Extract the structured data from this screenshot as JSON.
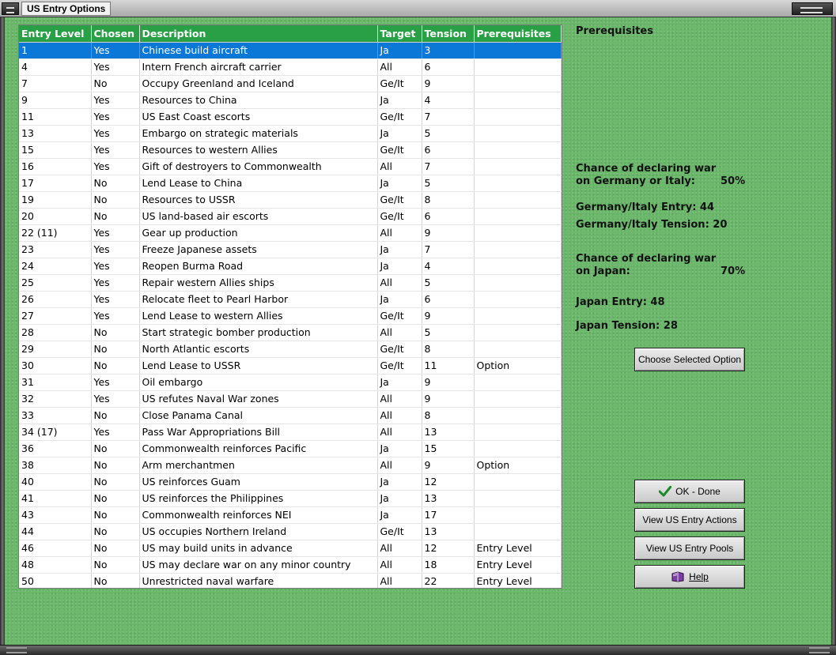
{
  "window": {
    "title": "US Entry Options"
  },
  "table": {
    "columns": [
      "Entry Level",
      "Chosen",
      "Description",
      "Target",
      "Tension",
      "Prerequisites"
    ],
    "selected_index": 0,
    "rows": [
      [
        "1",
        "Yes",
        "Chinese build aircraft",
        "Ja",
        "3",
        ""
      ],
      [
        "4",
        "Yes",
        "Intern French aircraft carrier",
        "All",
        "6",
        ""
      ],
      [
        "7",
        "No",
        "Occupy Greenland and Iceland",
        "Ge/It",
        "9",
        ""
      ],
      [
        "9",
        "Yes",
        "Resources to China",
        "Ja",
        "4",
        ""
      ],
      [
        "11",
        "Yes",
        "US East Coast escorts",
        "Ge/It",
        "7",
        ""
      ],
      [
        "13",
        "Yes",
        "Embargo on strategic materials",
        "Ja",
        "5",
        ""
      ],
      [
        "15",
        "Yes",
        "Resources to western Allies",
        "Ge/It",
        "6",
        ""
      ],
      [
        "16",
        "Yes",
        "Gift of destroyers to Commonwealth",
        "All",
        "7",
        ""
      ],
      [
        "17",
        "No",
        "Lend Lease to China",
        "Ja",
        "5",
        ""
      ],
      [
        "19",
        "No",
        "Resources to USSR",
        "Ge/It",
        "8",
        ""
      ],
      [
        "20",
        "No",
        "US land-based air escorts",
        "Ge/It",
        "6",
        ""
      ],
      [
        "22 (11)",
        "Yes",
        "Gear up production",
        "All",
        "9",
        ""
      ],
      [
        "23",
        "Yes",
        "Freeze Japanese assets",
        "Ja",
        "7",
        ""
      ],
      [
        "24",
        "Yes",
        "Reopen Burma Road",
        "Ja",
        "4",
        ""
      ],
      [
        "25",
        "Yes",
        "Repair western Allies ships",
        "All",
        "5",
        ""
      ],
      [
        "26",
        "Yes",
        "Relocate fleet to Pearl Harbor",
        "Ja",
        "6",
        ""
      ],
      [
        "27",
        "Yes",
        "Lend Lease to western Allies",
        "Ge/It",
        "9",
        ""
      ],
      [
        "28",
        "No",
        "Start strategic bomber production",
        "All",
        "5",
        ""
      ],
      [
        "29",
        "No",
        "North Atlantic escorts",
        "Ge/It",
        "8",
        ""
      ],
      [
        "30",
        "No",
        "Lend Lease to USSR",
        "Ge/It",
        "11",
        "Option"
      ],
      [
        "31",
        "Yes",
        "Oil embargo",
        "Ja",
        "9",
        ""
      ],
      [
        "32",
        "Yes",
        "US refutes Naval War zones",
        "All",
        "9",
        ""
      ],
      [
        "33",
        "No",
        "Close Panama Canal",
        "All",
        "8",
        ""
      ],
      [
        "34 (17)",
        "Yes",
        "Pass War Appropriations Bill",
        "All",
        "13",
        ""
      ],
      [
        "36",
        "No",
        "Commonwealth reinforces Pacific",
        "Ja",
        "15",
        ""
      ],
      [
        "38",
        "No",
        "Arm merchantmen",
        "All",
        "9",
        "Option"
      ],
      [
        "40",
        "No",
        "US reinforces Guam",
        "Ja",
        "12",
        ""
      ],
      [
        "41",
        "No",
        "US reinforces the Philippines",
        "Ja",
        "13",
        ""
      ],
      [
        "43",
        "No",
        "Commonwealth reinforces NEI",
        "Ja",
        "17",
        ""
      ],
      [
        "44",
        "No",
        "US occupies Northern Ireland",
        "Ge/It",
        "13",
        ""
      ],
      [
        "46",
        "No",
        "US may build units in advance",
        "All",
        "12",
        "Entry Level"
      ],
      [
        "48",
        "No",
        "US may declare war on any minor country",
        "All",
        "18",
        "Entry Level"
      ],
      [
        "50",
        "No",
        "Unrestricted naval warfare",
        "All",
        "22",
        "Entry Level"
      ]
    ]
  },
  "info": {
    "prereq_heading": "Prerequisites",
    "germany_chance_line1": "Chance of declaring war",
    "germany_chance_line2": "on Germany or Italy:",
    "germany_chance_value": "50%",
    "germany_entry": "Germany/Italy Entry: 44",
    "germany_tension": "Germany/Italy Tension: 20",
    "japan_chance_line1": "Chance of declaring war",
    "japan_chance_line2": "on Japan:",
    "japan_chance_value": "70%",
    "japan_entry": "Japan Entry: 48",
    "japan_tension": "Japan Tension: 28"
  },
  "buttons": {
    "choose": "Choose Selected Option",
    "ok": "OK - Done",
    "view_actions": "View US Entry Actions",
    "view_pools": "View US Entry Pools",
    "help": "Help"
  },
  "icons": {
    "ok": "checkmark-icon",
    "help": "help-book-icon"
  },
  "colors": {
    "header_bg": "#2aa046",
    "selected_row": "#0b78d8",
    "panel_bg": "#6ab76a"
  }
}
